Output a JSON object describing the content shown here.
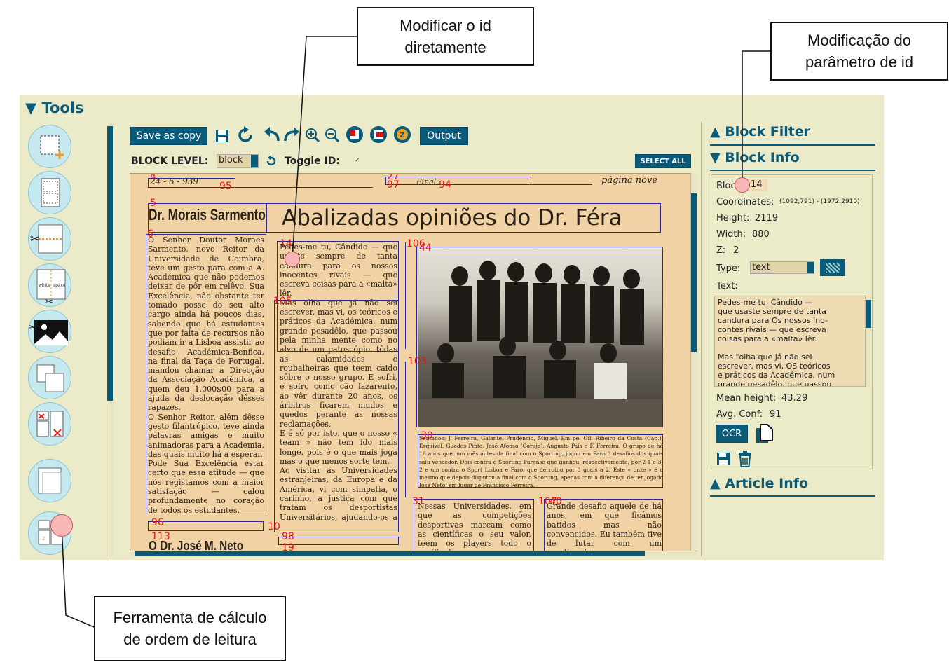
{
  "callouts": {
    "modify_id": "Modificar o id\ndiretamente",
    "id_param": "Modificação do\nparâmetro de id",
    "reading_order": "Ferramenta de cálculo\nde ordem de leitura"
  },
  "tools": {
    "title": "▼ Tools",
    "icons": [
      "add-block-icon",
      "blocks-list-icon",
      "cut-horizontal-icon",
      "white-space-cut-icon",
      "image-cut-icon",
      "overlap-blocks-icon",
      "delete-blocks-icon",
      "merge-blocks-icon",
      "reading-order-icon"
    ],
    "white_space_label": "white space"
  },
  "toolbar": {
    "save_as_copy": "Save as copy",
    "output": "Output",
    "block_level_label": "BLOCK LEVEL:",
    "block_level_value": "block",
    "toggle_id_label": "Toggle ID:",
    "toggle_id_check": "✓",
    "select_all": "SELECT ALL"
  },
  "document": {
    "date": "24 - 6 - 939",
    "page_label": "página nove",
    "final_label": "Final",
    "author": "Dr. Morais Sarmento",
    "headline": "Abalizadas opiniões do Dr. Féra",
    "col1": "O Senhor Doutor Moraes Sarmento, novo Reitor da Universidade de Coimbra, teve um gesto para com a A. Académica que não podemos deixar de pôr em relêvo. Sua Excelência, não obstante ter tomado posse do seu alto cargo ainda há poucos dias, sabendo que há estudantes que por falta de recursos não podiam ir a Lisboa assistir ao desafio Académica-Benfica, na final da Taça de Portugal, mandou chamar a Direcção da Associação Académica, a quem deu 1.000$00 para a ajuda da deslocação dêsses rapazes.\n  O Senhor Reitor, além dêsse gesto filantrópico, teve ainda palavras amigas e muito animadoras para a Academia, das quais muito há a esperar.\n  Pode Sua Excelência estar certo que essa atitude — que nós registamos com a maior satisfação — calou profundamente no coração de todos os estudantes.",
    "col1_bottom": "O Dr. José M. Neto",
    "col2": "Pedes-me tu, Cândido — que usaste sempre de tanta candura para os nossos inocentes rivais — que escreva coisas para a «malta» lêr.\n  Mas olha que já não sei escrever, mas vi, os teóricos e práticos da Académica, num grande pesadêlo, que passou pela minha mente como no alvo de um patoscópio, tôdas as calamidades e roubalheiras que teem caido sôbre o nosso grupo. E sofri, e sofro como cão lazarento, ao vêr durante 20 anos, os árbitros ficarem mudos e quedos perante as nossas reclamações.\n  E é só por isto, que o nosso « team » não tem ido mais longe, pois é o que mais joga mas o que menos sorte tem.\n  Ao visitar as Universidades estranjeiras, da Europa e da América, vi com simpatia, o carinho, a justiça com que tratam os desportistas Universitários, ajudando-os a ser bons « out-sid men » e preparando-os para a luta.",
    "caption": "Sentados: J. Ferreira, Galante, Prudêncio, Miguel. Em pé: Gil, Ribeiro da Costa (Cap.), Esquivel, Guedes Pinto, José Afonso (Coruja), Augusto Pais e F. Ferreira. O grupo de há 16 anos que, um mês antes da final com o Sporting, jogou em Faro 3 desafios dos quais saiu vencedor. Dois contra o Sporting Farense que ganhou, respectivamente, por 2-1 e 3-2 e um contra o Sport Lisboa e Faro, que derrotou por 3 goals a 2. Este « onze » é o mesmo que depois disputou a final com o Sporting, apenas com a diferença de ter jogado José Neto, em lugar de Francisco Ferreira.",
    "col3_bottom": "Nessas Universidades, em que as competições desportivas marcam como as científicas o seu valor, teem os players todo o auxílio dos seus",
    "col4_bottom": "Grande desafio aquele de há anos, em que ficámos batidos mas não convencidos. Eu também tive de lutar com um sportinguista, que me",
    "block_ids": [
      "4",
      "95",
      "27",
      "97",
      "94",
      "5",
      "6",
      "14",
      "106",
      "44",
      "105",
      "103",
      "30",
      "31",
      "107",
      "96",
      "10",
      "113",
      "98",
      "19",
      "40"
    ]
  },
  "block_filter": {
    "title": "Block Filter"
  },
  "block_info": {
    "title": "Block Info",
    "block_label": "Block",
    "block_value": "14",
    "coordinates_label": "Coordinates:",
    "coordinates_value": "(1092,791) - (1972,2910)",
    "height_label": "Height:",
    "height_value": "2119",
    "width_label": "Width:",
    "width_value": "880",
    "z_label": "Z:",
    "z_value": "2",
    "type_label": "Type:",
    "type_value": "text",
    "text_label": "Text:",
    "text_value": "Pedes-me tu, Cândido —\nque usaste sempre de tanta\ncandura para Os nossos Ino-\ncontes rivais — que escreva\ncoisas para a «malta» lêr.\n\nMas \"olha que já não sei\nescrever, mas vi, OS teóricos\ne práticos da Académica, num\ngrande pesadêlo, que passou",
    "mean_height_label": "Mean height:",
    "mean_height_value": "43.29",
    "avg_conf_label": "Avg. Conf:",
    "avg_conf_value": "91",
    "ocr_label": "OCR"
  },
  "article_info": {
    "title": "Article Info"
  },
  "colors": {
    "accent": "#0a5b7a",
    "panel": "#ecebc9",
    "bbox": "#2a2a9c",
    "id_text": "#e01515"
  }
}
